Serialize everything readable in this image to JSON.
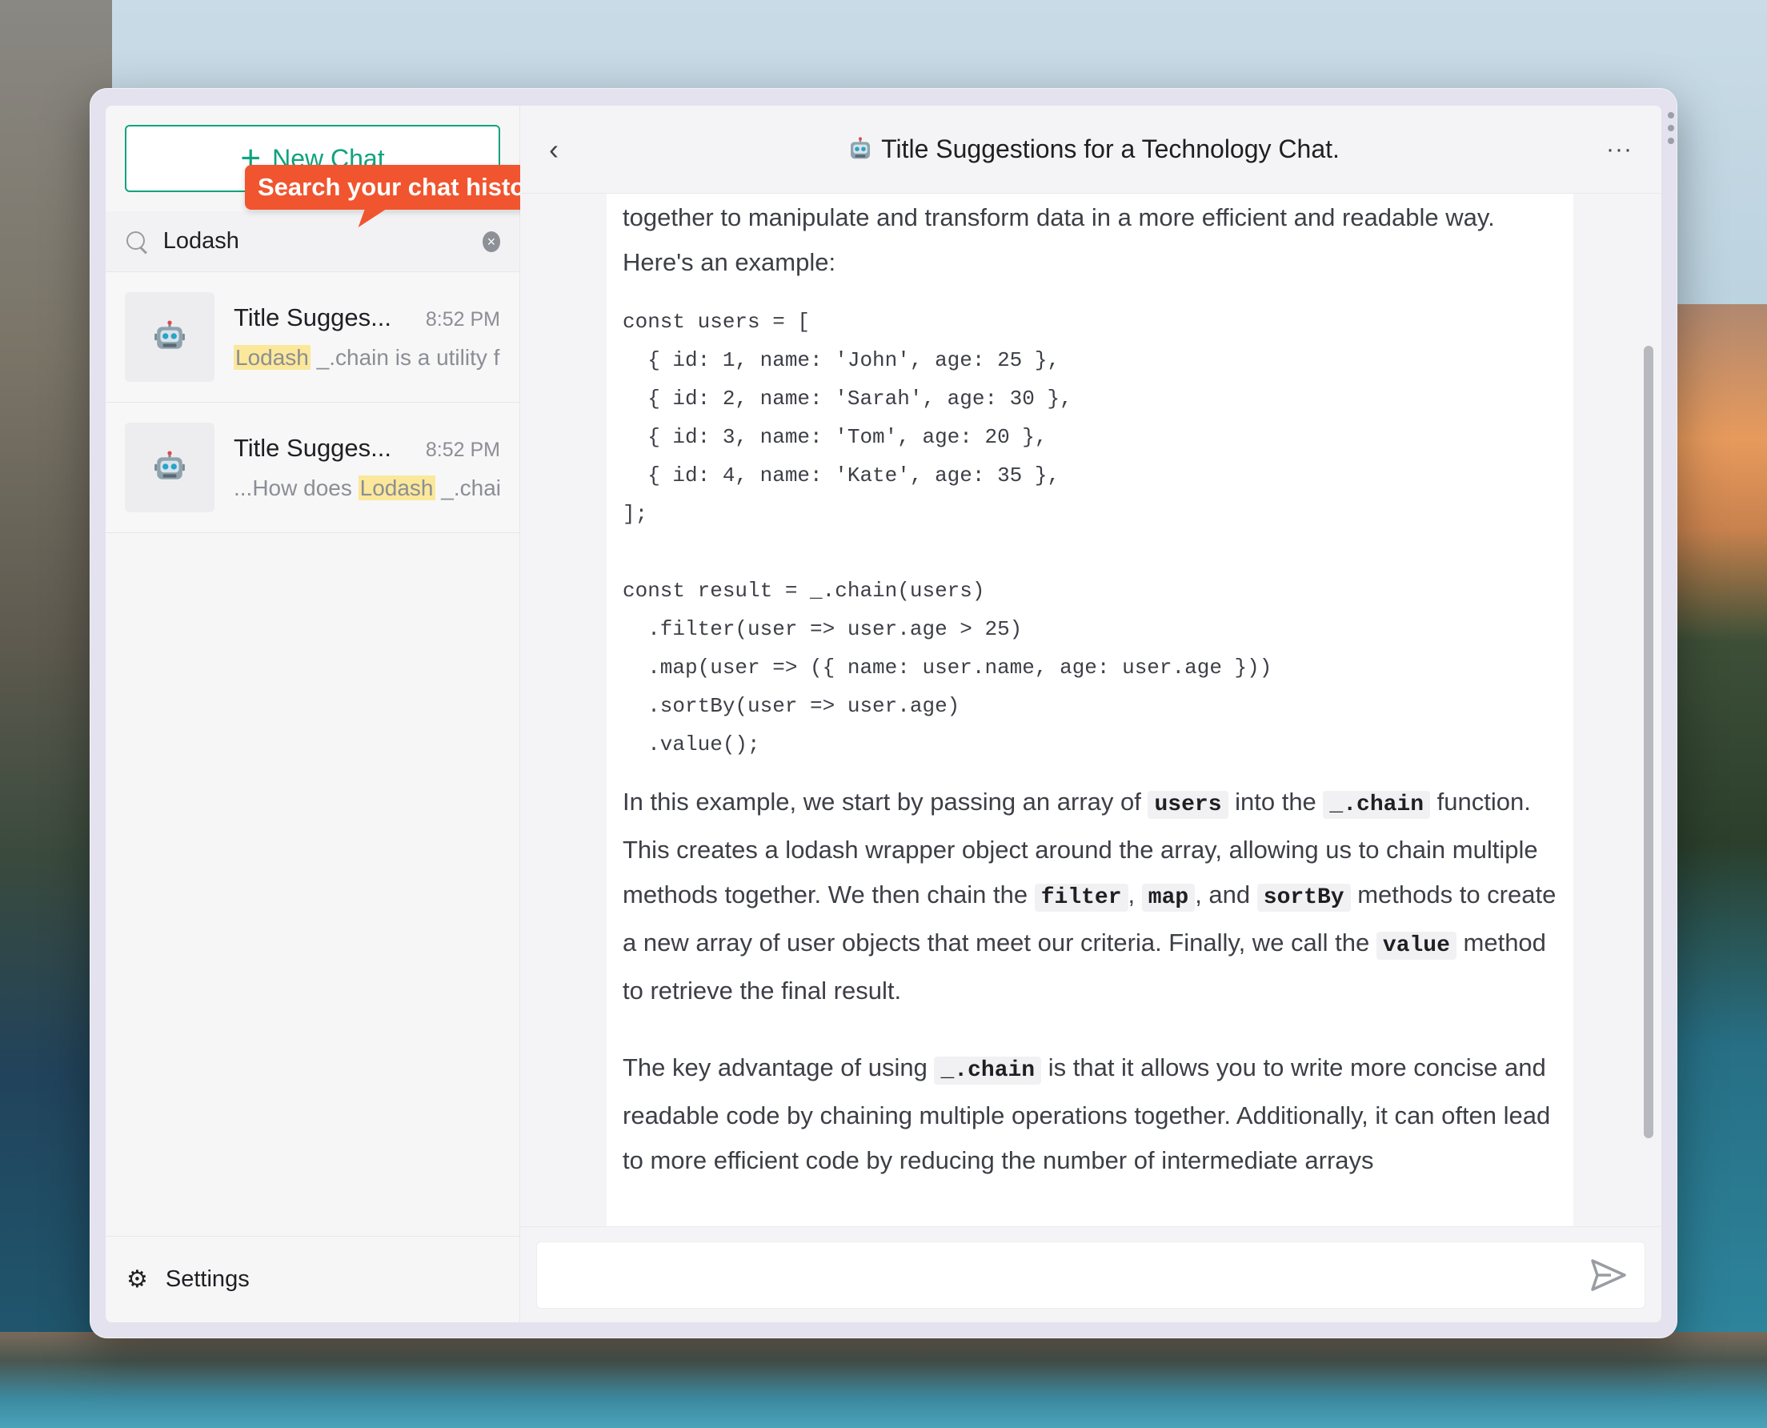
{
  "sidebar": {
    "new_chat_label": "New Chat",
    "tooltip": "Search your chat history",
    "search": {
      "value": "Lodash",
      "placeholder": ""
    },
    "items": [
      {
        "title": "Title Sugges...",
        "time": "8:52 PM",
        "snippet_pre": "",
        "snippet_hl": "Lodash",
        "snippet_post": " _.chain is a utility f"
      },
      {
        "title": "Title Sugges...",
        "time": "8:52 PM",
        "snippet_pre": "...How does ",
        "snippet_hl": "Lodash",
        "snippet_post": " _.chai"
      }
    ],
    "settings_label": "Settings"
  },
  "header": {
    "title": "Title Suggestions for a Technology Chat."
  },
  "message": {
    "intro_line1": "together to manipulate and transform data in a more efficient and readable way.",
    "intro_line2": "Here's an example:",
    "code": "const users = [\n  { id: 1, name: 'John', age: 25 },\n  { id: 2, name: 'Sarah', age: 30 },\n  { id: 3, name: 'Tom', age: 20 },\n  { id: 4, name: 'Kate', age: 35 },\n];\n\nconst result = _.chain(users)\n  .filter(user => user.age > 25)\n  .map(user => ({ name: user.name, age: user.age }))\n  .sortBy(user => user.age)\n  .value();",
    "p2": {
      "t1": "In this example, we start by passing an array of ",
      "c1": "users",
      "t2": " into the ",
      "c2": "_.chain",
      "t3": " function. This creates a lodash wrapper object around the array, allowing us to chain multiple methods together. We then chain the ",
      "c3": "filter",
      "t4": ", ",
      "c4": "map",
      "t5": ", and ",
      "c5": "sortBy",
      "t6": " methods to create a new array of user objects that meet our criteria. Finally, we call the ",
      "c6": "value",
      "t7": " method to retrieve the final result."
    },
    "p3": {
      "t1": "The key advantage of using ",
      "c1": "_.chain",
      "t2": " is that it allows you to write more concise and readable code by chaining multiple operations together. Additionally, it can often lead to more efficient code by reducing the number of intermediate arrays"
    }
  },
  "composer": {
    "value": "",
    "placeholder": ""
  },
  "colors": {
    "accent": "#10a37f",
    "tooltip": "#f0552f",
    "highlight": "#fbe89a"
  },
  "icons": [
    "plus-icon",
    "search-icon",
    "clear-icon",
    "robot-icon",
    "gear-icon",
    "back-icon",
    "more-icon",
    "send-icon"
  ]
}
